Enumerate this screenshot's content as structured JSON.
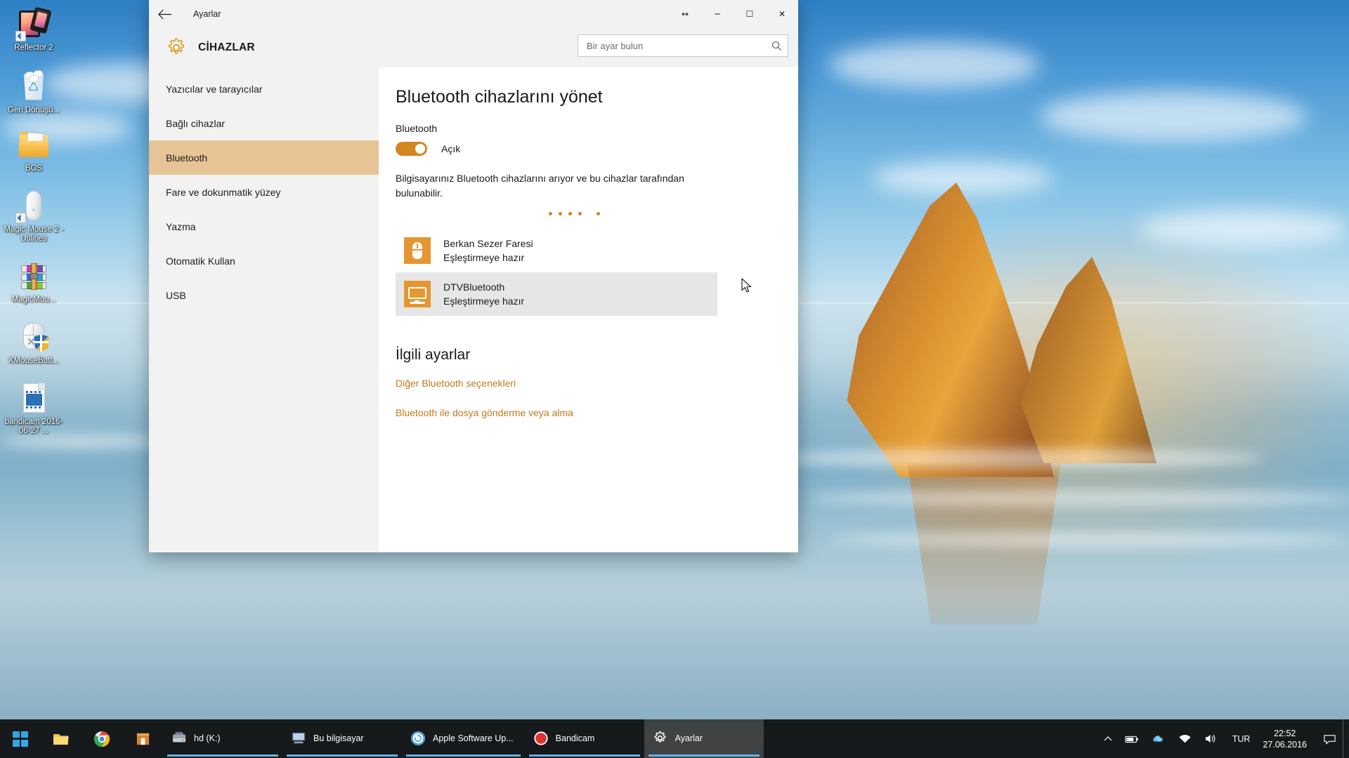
{
  "desktop": {
    "icons": [
      {
        "label": "Reflector 2",
        "icon": "reflector-app-icon",
        "shortcut": true
      },
      {
        "label": "Geri Dönüşü...",
        "icon": "recycle-bin-icon",
        "shortcut": false
      },
      {
        "label": "BOS",
        "icon": "folder-icon",
        "shortcut": false
      },
      {
        "label": "Magic Mouse 2 - Utilities",
        "icon": "magic-mouse-icon",
        "shortcut": true
      },
      {
        "label": "MagicMou...",
        "icon": "winrar-archive-icon",
        "shortcut": false
      },
      {
        "label": "XMouseButt...",
        "icon": "xmouse-button-control-icon",
        "shortcut": false
      },
      {
        "label": "bandicam 2016-06-27 ...",
        "icon": "video-file-icon",
        "shortcut": false
      }
    ]
  },
  "window": {
    "title": "Ayarlar",
    "back_icon": "back-arrow-icon",
    "caption": {
      "restore_down_label": "↔",
      "minimize_label": "─",
      "maximize_label": "☐",
      "close_label": "✕"
    },
    "header": {
      "icon": "gear-icon",
      "title": "CİHAZLAR"
    },
    "search": {
      "placeholder": "Bir ayar bulun",
      "value": "",
      "icon": "search-icon"
    }
  },
  "sidebar": {
    "items": [
      {
        "label": "Yazıcılar ve tarayıcılar",
        "selected": false
      },
      {
        "label": "Bağlı cihazlar",
        "selected": false
      },
      {
        "label": "Bluetooth",
        "selected": true
      },
      {
        "label": "Fare ve dokunmatik yüzey",
        "selected": false
      },
      {
        "label": "Yazma",
        "selected": false
      },
      {
        "label": "Otomatik Kullan",
        "selected": false
      },
      {
        "label": "USB",
        "selected": false
      }
    ]
  },
  "content": {
    "heading": "Bluetooth cihazlarını yönet",
    "bluetooth_label": "Bluetooth",
    "toggle_state": "Açık",
    "toggle_on": true,
    "description": "Bilgisayarınız Bluetooth cihazlarını arıyor ve bu cihazlar tarafından bulunabilir.",
    "devices": [
      {
        "name": "Berkan Sezer Faresi",
        "status": "Eşleştirmeye hazır",
        "icon": "mouse-device-icon",
        "hovered": false
      },
      {
        "name": "DTVBluetooth",
        "status": "Eşleştirmeye hazır",
        "icon": "monitor-device-icon",
        "hovered": true
      }
    ],
    "related_heading": "İlgili ayarlar",
    "related_links": [
      {
        "label": "Diğer Bluetooth seçenekleri"
      },
      {
        "label": "Bluetooth ile dosya gönderme veya alma"
      }
    ]
  },
  "taskbar": {
    "start_label": "Başlat",
    "quick_launch": [
      {
        "name": "file-explorer-icon"
      },
      {
        "name": "google-chrome-icon"
      },
      {
        "name": "store-icon"
      }
    ],
    "tasks": [
      {
        "label": "hd (K:)",
        "icon": "drive-icon",
        "active": false
      },
      {
        "label": "Bu bilgisayar",
        "icon": "this-pc-icon",
        "active": false
      },
      {
        "label": "Apple Software Up...",
        "icon": "apple-software-update-icon",
        "active": false
      },
      {
        "label": "Bandicam",
        "icon": "bandicam-icon",
        "active": false
      },
      {
        "label": "Ayarlar",
        "icon": "settings-gear-icon",
        "active": true
      }
    ],
    "tray": {
      "chevron": "show-hidden-icons-chevron",
      "icons": [
        "battery-icon",
        "onedrive-icon",
        "network-icon",
        "volume-icon",
        "action-center-icon"
      ],
      "language": "TUR",
      "time": "22:52",
      "date": "27.06.2016"
    }
  },
  "colors": {
    "accent": "#d3851f",
    "link": "#c07a1e",
    "selection": "#e6c496",
    "device_icon": "#e59630",
    "hover_row": "#e6e6e6"
  }
}
